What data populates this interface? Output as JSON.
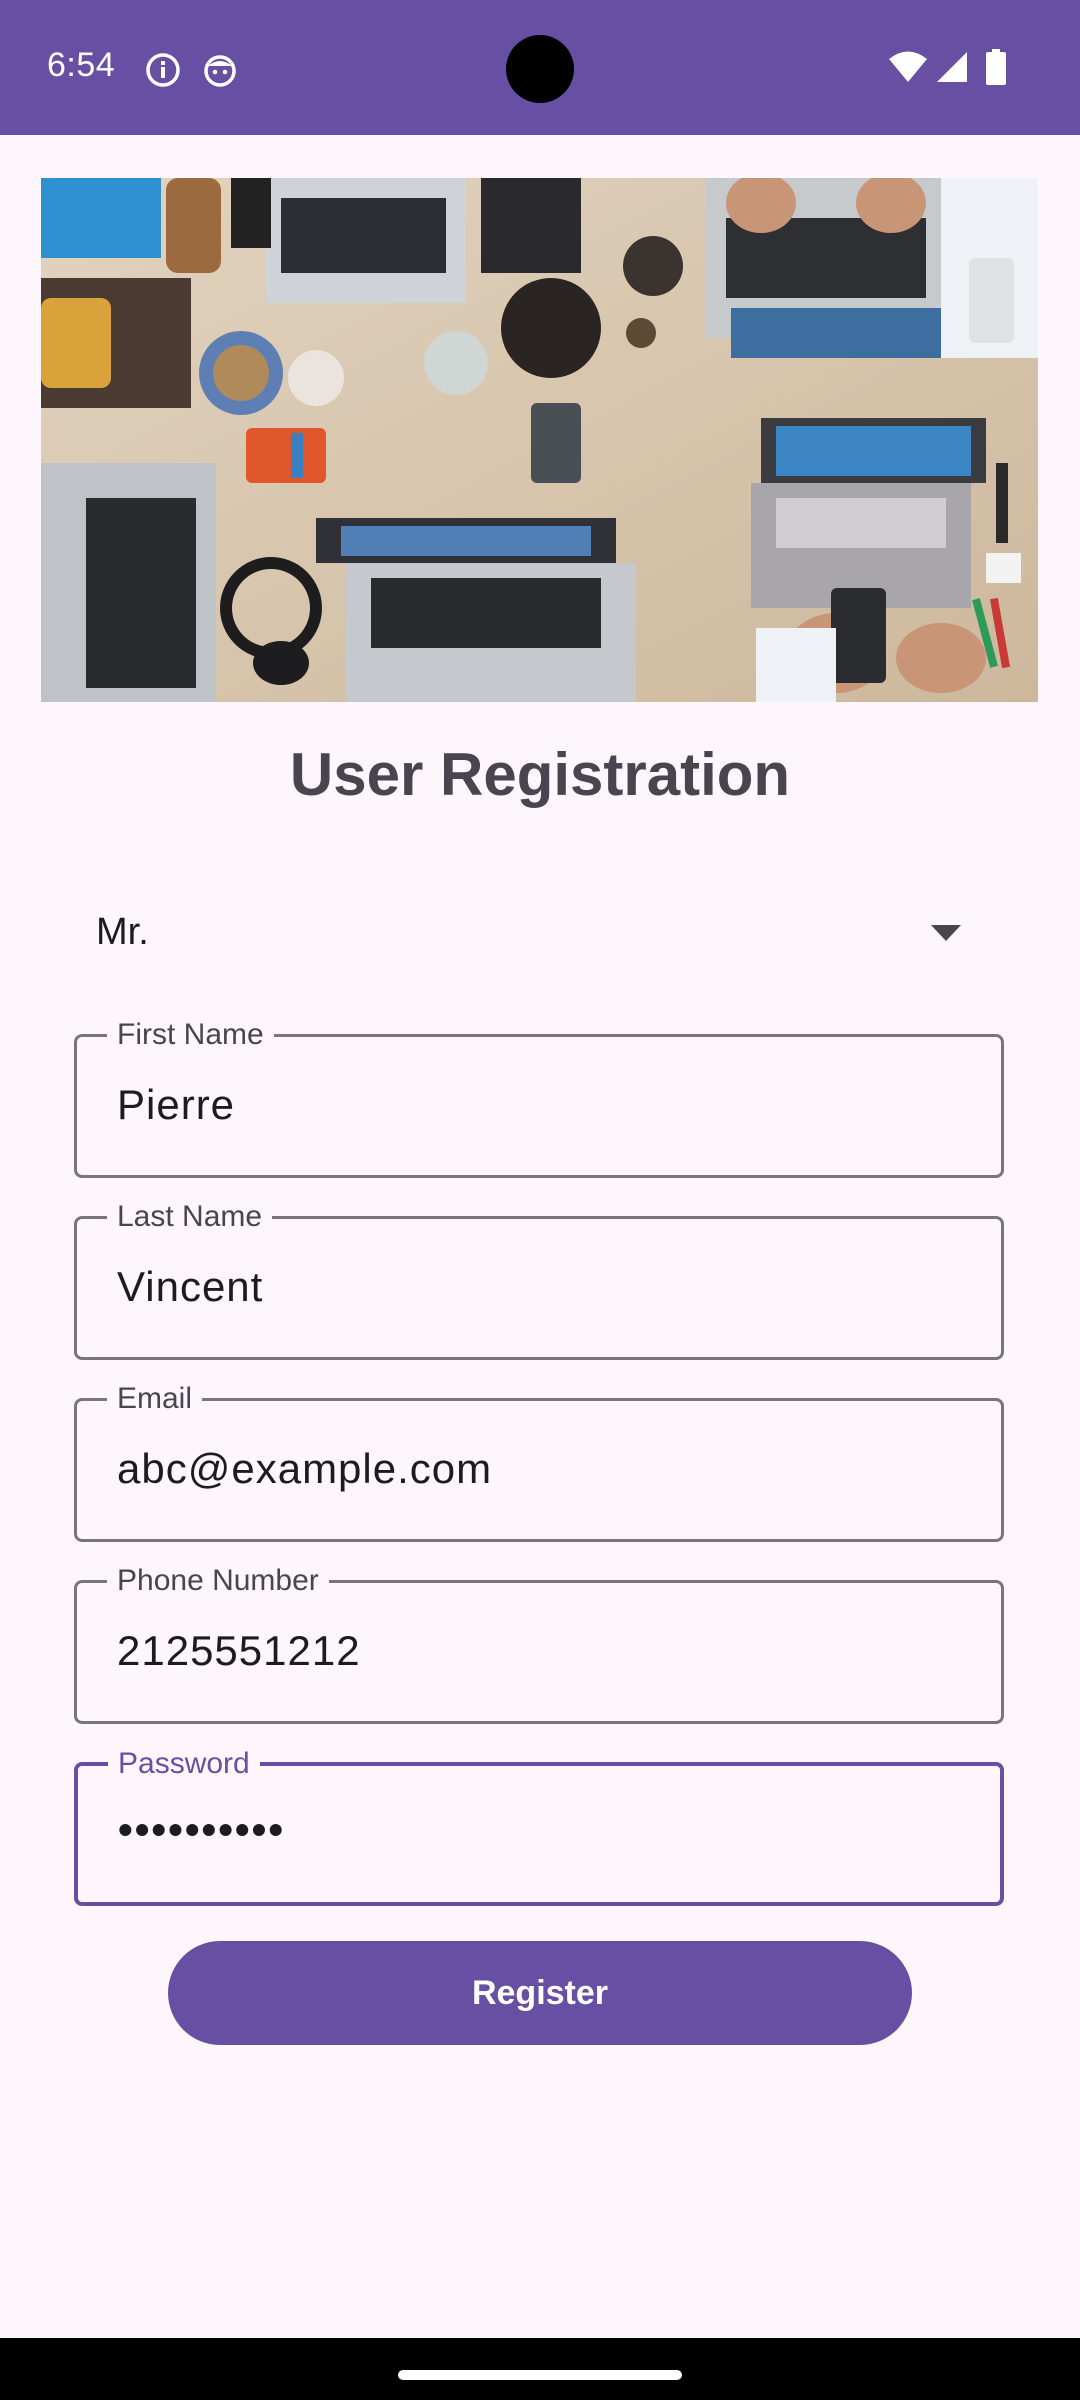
{
  "status_bar": {
    "time": "6:54",
    "icons": [
      "info-icon",
      "face-icon",
      "wifi-icon",
      "signal-icon",
      "battery-icon"
    ],
    "background_color": "#6750a4"
  },
  "hero_image": {
    "description_icon": "desk-with-laptops-photo"
  },
  "page": {
    "title": "User Registration"
  },
  "form": {
    "salutation": {
      "selected": "Mr."
    },
    "fields": [
      {
        "label": "First Name",
        "value": "Pierre"
      },
      {
        "label": "Last Name",
        "value": "Vincent"
      },
      {
        "label": "Email",
        "value": "abc@example.com"
      },
      {
        "label": "Phone Number",
        "value": "2125551212"
      },
      {
        "label": "Password",
        "value": "••••••••••"
      }
    ],
    "register_label": "Register"
  },
  "colors": {
    "accent": "#6750a4",
    "background": "#fdf7fd",
    "outline": "#79747e"
  }
}
